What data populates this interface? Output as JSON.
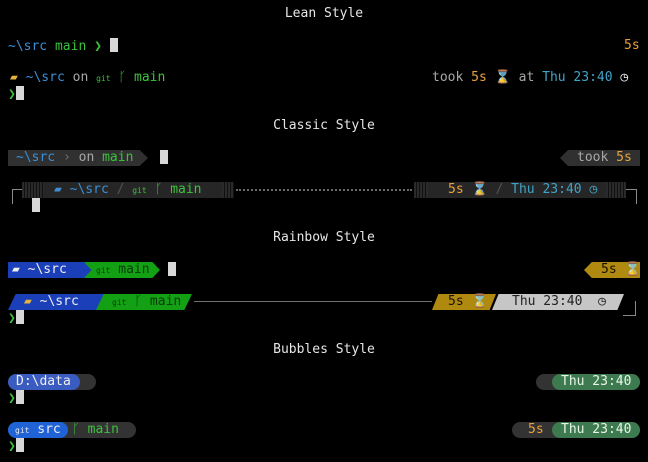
{
  "headers": {
    "lean": "Lean Style",
    "classic": "Classic Style",
    "rainbow": "Rainbow Style",
    "bubbles": "Bubbles Style"
  },
  "lean": {
    "line1_dir": "~\\src",
    "line1_branch": "main",
    "line1_arrow": "❯",
    "line1_right": "5s",
    "line2_dir": "~\\src",
    "line2_on": "on",
    "line2_branch": "main",
    "line2_took": "took",
    "line2_duration": "5s",
    "line2_at": "at",
    "line2_time": "Thu 23:40",
    "line3_arrow": "❯"
  },
  "classic": {
    "line1_dir": "~\\src",
    "line1_on": "on",
    "line1_branch": "main",
    "line1_took": "took",
    "line1_duration": "5s",
    "line2_dir": "~\\src",
    "line2_branch": "main",
    "line2_duration": "5s",
    "line2_time": "Thu 23:40"
  },
  "rainbow": {
    "line1_dir": "~\\src",
    "line1_branch": "main",
    "line1_duration": "5s",
    "line2_dir": "~\\src",
    "line2_branch": "main",
    "line2_duration": "5s",
    "line2_time": "Thu 23:40",
    "line3_arrow": "❯"
  },
  "bubbles": {
    "line1_dir": "D:\\data",
    "line1_time": "Thu 23:40",
    "line2_arrow": "❯",
    "line3_dir": "src",
    "line3_branch": "main",
    "line3_duration": "5s",
    "line3_time": "Thu 23:40",
    "line4_arrow": "❯"
  },
  "colors": {
    "blue": "#3a8fd6",
    "green": "#3cc23c",
    "orange": "#e9a13b",
    "teal": "#41a3c8",
    "rainbow_dir_bg": "#1a3fb8",
    "rainbow_git_bg": "#14a014",
    "rainbow_dur_bg": "#b08a10",
    "rainbow_time_bg": "#c6c6c6",
    "bubble_dir_bg": "#3a5bbf",
    "bubble_time_bg": "#3d7a4f"
  }
}
